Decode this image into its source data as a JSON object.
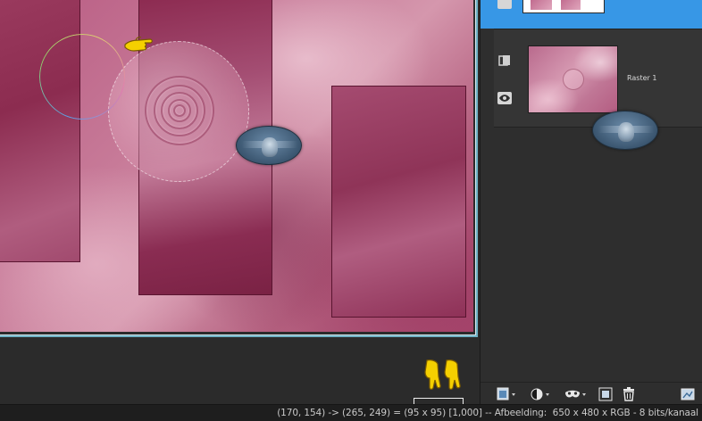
{
  "layers_panel": {
    "layers": [
      {
        "name": "",
        "active": true
      },
      {
        "name": "Raster 1",
        "active": false
      }
    ]
  },
  "status_bar": {
    "cursor_position": "(170, 154)",
    "arrow": "->",
    "selection_end": "(265, 249)",
    "equals": "=",
    "selection_size": "(95 x 95)",
    "zoom_value": "[1,000]",
    "separator": "--",
    "image_label": "Afbeelding:",
    "image_info": "650 x 480 x RGB - 8 bits/kanaal"
  },
  "colors": {
    "active_layer": "#3797e6",
    "panel_bg": "#2e2e2e",
    "canvas_border": "#6fb3c7",
    "pointer_hand": "#f5d000"
  },
  "icons": {
    "pointer_hand": "hand-pointing-icon",
    "eye": "eye-icon",
    "layer_group": "layer-group-icon",
    "new_layer": "new-layer-icon",
    "mask": "mask-icon",
    "adjustment": "adjustment-layer-icon",
    "duplicate": "duplicate-layer-icon",
    "delete": "trash-icon",
    "properties": "layer-properties-icon"
  }
}
